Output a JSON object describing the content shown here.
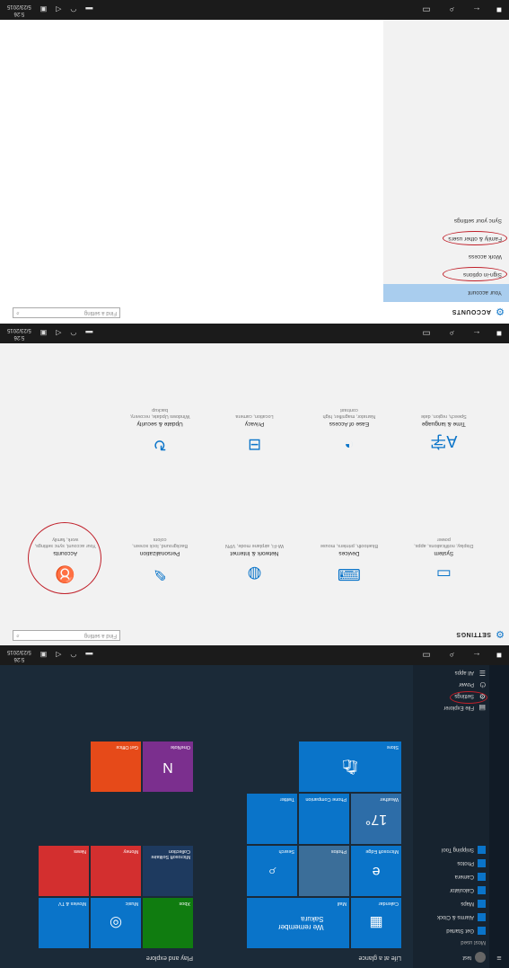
{
  "taskbar": {
    "time": "5:26",
    "date": "5/23/2015"
  },
  "panel_accounts": {
    "title": "ACCOUNTS",
    "find_placeholder": "Find a setting",
    "items": [
      "Your account",
      "Sign-in options",
      "Work access",
      "Family & other users",
      "Sync your settings"
    ]
  },
  "panel_settings": {
    "title": "SETTINGS",
    "find_placeholder": "Find a setting",
    "tiles": [
      {
        "name": "System",
        "desc": "Display, notifications, apps, power",
        "icon": "system-icon"
      },
      {
        "name": "Devices",
        "desc": "Bluetooth, printers, mouse",
        "icon": "devices-icon"
      },
      {
        "name": "Network & Internet",
        "desc": "Wi-Fi, airplane mode, VPN",
        "icon": "network-icon"
      },
      {
        "name": "Personalization",
        "desc": "Background, lock screen, colors",
        "icon": "personalization-icon"
      },
      {
        "name": "Accounts",
        "desc": "Your account, sync settings, work, family",
        "icon": "accounts-icon"
      },
      {
        "name": "Time & language",
        "desc": "Speech, region, date",
        "icon": "time-language-icon"
      },
      {
        "name": "Ease of Access",
        "desc": "Narrator, magnifier, high contrast",
        "icon": "ease-of-access-icon"
      },
      {
        "name": "Privacy",
        "desc": "Location, camera",
        "icon": "privacy-icon"
      },
      {
        "name": "Update & security",
        "desc": "Windows Update, recovery, backup",
        "icon": "update-icon"
      }
    ]
  },
  "start_menu": {
    "user": "test",
    "most_used_label": "Most used",
    "apps": [
      "Get Started",
      "Alarms & Clock",
      "Maps",
      "Calculator",
      "Camera",
      "Photos",
      "Snipping Tool"
    ],
    "bottom": [
      "File Explorer",
      "Settings",
      "Power",
      "All apps"
    ],
    "groups": [
      "Life at a glance",
      "Play and explore"
    ],
    "tiles": [
      "Mail",
      "Calendar",
      "Microsoft Edge",
      "Photos",
      "Search",
      "Weather",
      "Phone Companion",
      "Twitter",
      "Store",
      "Xbox",
      "Music",
      "Movies & TV",
      "Microsoft Solitaire Collection",
      "Money",
      "News",
      "OneNote",
      "Get Office"
    ],
    "weather_temp": "17°",
    "calendar_text": "We remember Sakura"
  }
}
